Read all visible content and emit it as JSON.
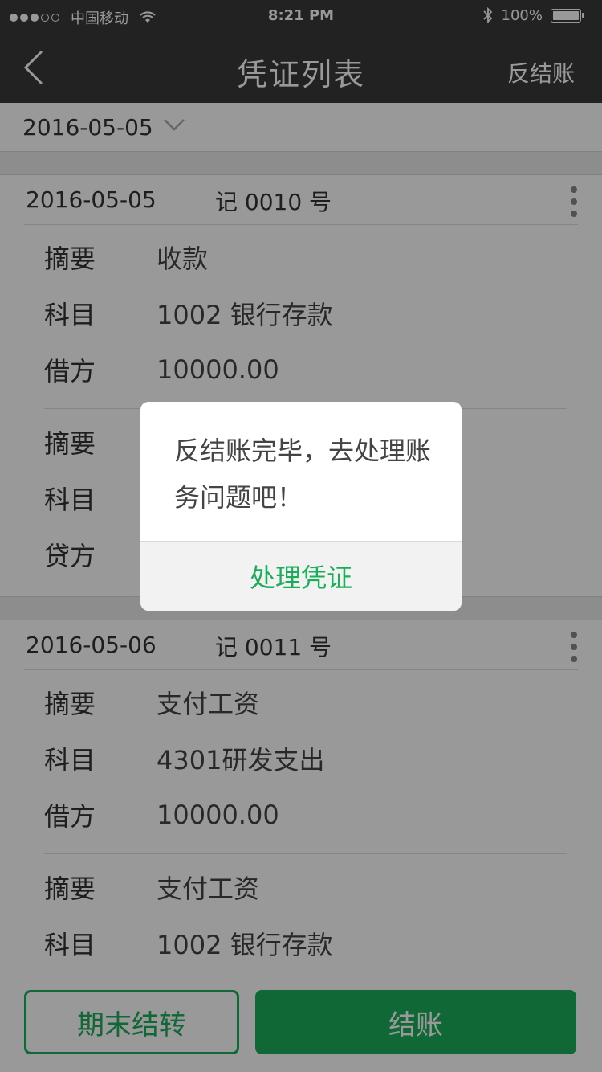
{
  "status_bar": {
    "carrier": "中国移动",
    "time": "8:21 PM",
    "battery": "100%"
  },
  "nav": {
    "title": "凭证列表",
    "action": "反结账",
    "back_icon": "chevron-left-icon"
  },
  "filter": {
    "date": "2016-05-05",
    "dropdown_icon": "chevron-down-icon"
  },
  "vouchers": [
    {
      "date": "2016-05-05",
      "number": "记 0010 号",
      "entries": [
        {
          "summary_label": "摘要",
          "summary": "收款",
          "subject_label": "科目",
          "subject": "1002 银行存款",
          "side_label": "借方",
          "amount": "10000.00"
        },
        {
          "summary_label": "摘要",
          "summary": "",
          "subject_label": "科目",
          "subject": "",
          "side_label": "贷方",
          "amount": ""
        }
      ]
    },
    {
      "date": "2016-05-06",
      "number": "记 0011 号",
      "entries": [
        {
          "summary_label": "摘要",
          "summary": "支付工资",
          "subject_label": "科目",
          "subject": "4301研发支出",
          "side_label": "借方",
          "amount": "10000.00"
        },
        {
          "summary_label": "摘要",
          "summary": "支付工资",
          "subject_label": "科目",
          "subject": "1002 银行存款"
        }
      ]
    }
  ],
  "buttons": {
    "period_end": "期末结转",
    "close_books": "结账"
  },
  "dialog": {
    "message": "反结账完毕，去处理账务问题吧！",
    "action": "处理凭证"
  },
  "colors": {
    "accent": "#1aad5a",
    "nav_bg": "#3a3a3a"
  }
}
